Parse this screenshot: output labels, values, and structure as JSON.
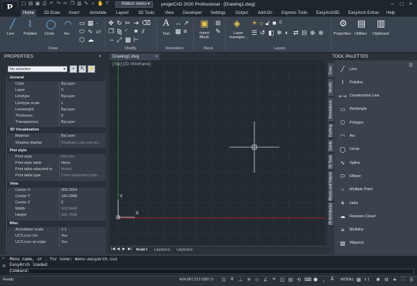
{
  "app": {
    "title": "progeCAD 2020 Professional - [Drawing1.dwg]",
    "logo": "P",
    "quick_access_label": "Ribbon menu"
  },
  "menu_tabs": [
    "Home",
    "2D Draw",
    "Insert",
    "Annotate",
    "Layout",
    "3D Tools",
    "View",
    "Developer",
    "Settings",
    "Output",
    "Add-On",
    "Express Tools",
    "EasyArch3D",
    "EasyArch Extras",
    "Help"
  ],
  "ribbon": {
    "draw_tools": [
      "Line",
      "Polyline",
      "Circle",
      "Arc"
    ],
    "text_tool": "Text",
    "insert_block": "Insert Block",
    "layer_manager": "Layer manager...",
    "properties": "Properties",
    "utilities": "Utilities",
    "clipboard": "Clipboard",
    "groups": [
      "Draw",
      "Modify",
      "Annotation",
      "Block",
      "Layers"
    ],
    "layer_value": "0"
  },
  "properties_panel": {
    "title": "PROPERTIES",
    "selection": "No selection",
    "sections": [
      {
        "name": "General",
        "rows": [
          [
            "Color",
            "ByLayer"
          ],
          [
            "Layer",
            "0"
          ],
          [
            "Linetype",
            "ByLayer"
          ],
          [
            "Linetype scale",
            "1"
          ],
          [
            "Lineweight",
            "ByLayer"
          ],
          [
            "Thickness",
            "0"
          ],
          [
            "Transparency",
            "ByLayer"
          ]
        ]
      },
      {
        "name": "3D Visualisation",
        "rows": [
          [
            "Material",
            "ByLayer"
          ],
          [
            "Shadow display",
            "Shadows cast and rec..."
          ]
        ]
      },
      {
        "name": "Plot style",
        "rows": [
          [
            "Print style",
            "ByColor"
          ],
          [
            "Print style table",
            "None"
          ],
          [
            "Print table attached to",
            "Model"
          ],
          [
            "Print table type",
            "Color-dependent prin..."
          ]
        ]
      },
      {
        "name": "View",
        "rows": [
          [
            "Center X",
            "309.2654"
          ],
          [
            "Center Y",
            "194.3988"
          ],
          [
            "Center Z",
            "0"
          ],
          [
            "Width",
            "928.6446"
          ],
          [
            "Height",
            "430.7568"
          ]
        ]
      },
      {
        "name": "Misc",
        "rows": [
          [
            "Annotation scale",
            "1:1"
          ],
          [
            "UCS icon On",
            "Yes"
          ],
          [
            "UCS icon at origin",
            "Yes"
          ]
        ]
      }
    ]
  },
  "drawing": {
    "tab": "Drawing1.dwg",
    "view_label": "[Top] [2D Wireframe]",
    "layout_tabs": [
      "Model",
      "Layout1",
      "Layout2"
    ],
    "ucs_x": "X",
    "ucs_y": "Y"
  },
  "tool_palettes": {
    "title": "TOOL PALETTES",
    "vertical_tabs": [
      "Draw",
      "Modify",
      "Annotations",
      "Drafting",
      "Solids",
      "3D Tools",
      "Blocks and Hatches",
      "2D Architectural"
    ],
    "items": [
      [
        "Line",
        "line-icon"
      ],
      [
        "Polyline",
        "polyline-icon"
      ],
      [
        "Construction Line",
        "construction-line-icon"
      ],
      [
        "Rectangle",
        "rectangle-icon"
      ],
      [
        "Polygon",
        "polygon-icon"
      ],
      [
        "Arc",
        "arc-icon"
      ],
      [
        "Circle",
        "circle-icon"
      ],
      [
        "Spline",
        "spline-icon"
      ],
      [
        "Ellipse",
        "ellipse-icon"
      ],
      [
        "Multiple Point",
        "multiple-point-icon"
      ],
      [
        "Helix",
        "helix-icon"
      ],
      [
        "Revision Cloud",
        "revision-cloud-icon"
      ],
      [
        "Multiline",
        "multiline-icon"
      ],
      [
        "Wipeout",
        "wipeout-icon"
      ]
    ]
  },
  "command": {
    "lines": [
      "Menu name, or . for none: menu-easyarch.cui",
      "EasyArch loaded"
    ],
    "prompt": "Command:"
  },
  "status": {
    "ready": "Ready",
    "coords": "424.067,217.0357,0",
    "model": "MODEL",
    "scale": "1:1"
  },
  "colors": {
    "accent": "#6fb6f0",
    "background": "#232a31",
    "x_axis": "#d01c2a",
    "y_axis": "#1f9b3a"
  }
}
